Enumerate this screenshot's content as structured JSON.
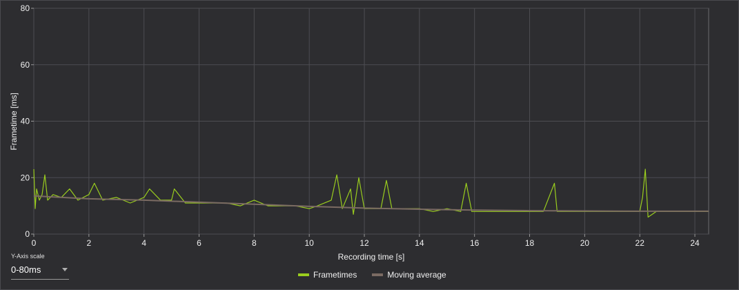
{
  "chart_data": {
    "type": "line",
    "xlabel": "Recording time [s]",
    "ylabel": "Frametime [ms]",
    "xlim": [
      0,
      24.5
    ],
    "ylim": [
      0,
      80
    ],
    "x_ticks": [
      0,
      2,
      4,
      6,
      8,
      10,
      12,
      14,
      16,
      18,
      20,
      22,
      24
    ],
    "y_ticks": [
      0,
      20,
      40,
      60,
      80
    ],
    "grid": true,
    "legend_position": "bottom-center",
    "series": [
      {
        "name": "Frametimes",
        "color": "#9acd1e",
        "x": [
          0,
          0.05,
          0.1,
          0.2,
          0.3,
          0.4,
          0.5,
          0.7,
          1.0,
          1.3,
          1.6,
          2.0,
          2.2,
          2.5,
          3.0,
          3.5,
          4.0,
          4.2,
          4.6,
          5.0,
          5.1,
          5.5,
          6.0,
          6.5,
          7.0,
          7.5,
          8.0,
          8.5,
          9.0,
          9.5,
          10.0,
          10.3,
          10.8,
          11.0,
          11.2,
          11.5,
          11.6,
          11.8,
          12.0,
          12.3,
          12.6,
          12.8,
          13.0,
          13.5,
          14.0,
          14.5,
          15.0,
          15.5,
          15.7,
          15.9,
          16.2,
          16.5,
          17.0,
          17.5,
          18.0,
          18.5,
          18.9,
          19.0,
          19.5,
          20.0,
          20.5,
          21.0,
          21.5,
          22.0,
          22.1,
          22.2,
          22.3,
          22.6,
          23.0,
          23.5,
          24.0,
          24.5
        ],
        "y": [
          23,
          9,
          16,
          12,
          14,
          21,
          12,
          14,
          13,
          16,
          12,
          14,
          18,
          12,
          13,
          11,
          13,
          16,
          12,
          12,
          16,
          11,
          11,
          11,
          11,
          10,
          12,
          10,
          10,
          10,
          9,
          10,
          12,
          21,
          9,
          16,
          7,
          20,
          9,
          9,
          9,
          19,
          9,
          9,
          9,
          8,
          9,
          8,
          18,
          8,
          8,
          8,
          8,
          8,
          8,
          8,
          18,
          8,
          8,
          8,
          8,
          8,
          8,
          8,
          13,
          23,
          6,
          8,
          8,
          8,
          8,
          8
        ]
      },
      {
        "name": "Moving average",
        "color": "#7b6b63",
        "x": [
          0,
          2,
          4,
          6,
          8,
          10,
          12,
          14,
          16,
          18,
          20,
          22,
          24,
          24.5
        ],
        "y": [
          13.5,
          12.5,
          12,
          11.3,
          10.6,
          9.8,
          9.2,
          8.8,
          8.5,
          8.3,
          8.2,
          8.1,
          8.1,
          8.1
        ]
      }
    ]
  },
  "controls": {
    "y_axis_scale_label": "Y-Axis scale",
    "y_axis_scale_value": "0-80ms"
  }
}
